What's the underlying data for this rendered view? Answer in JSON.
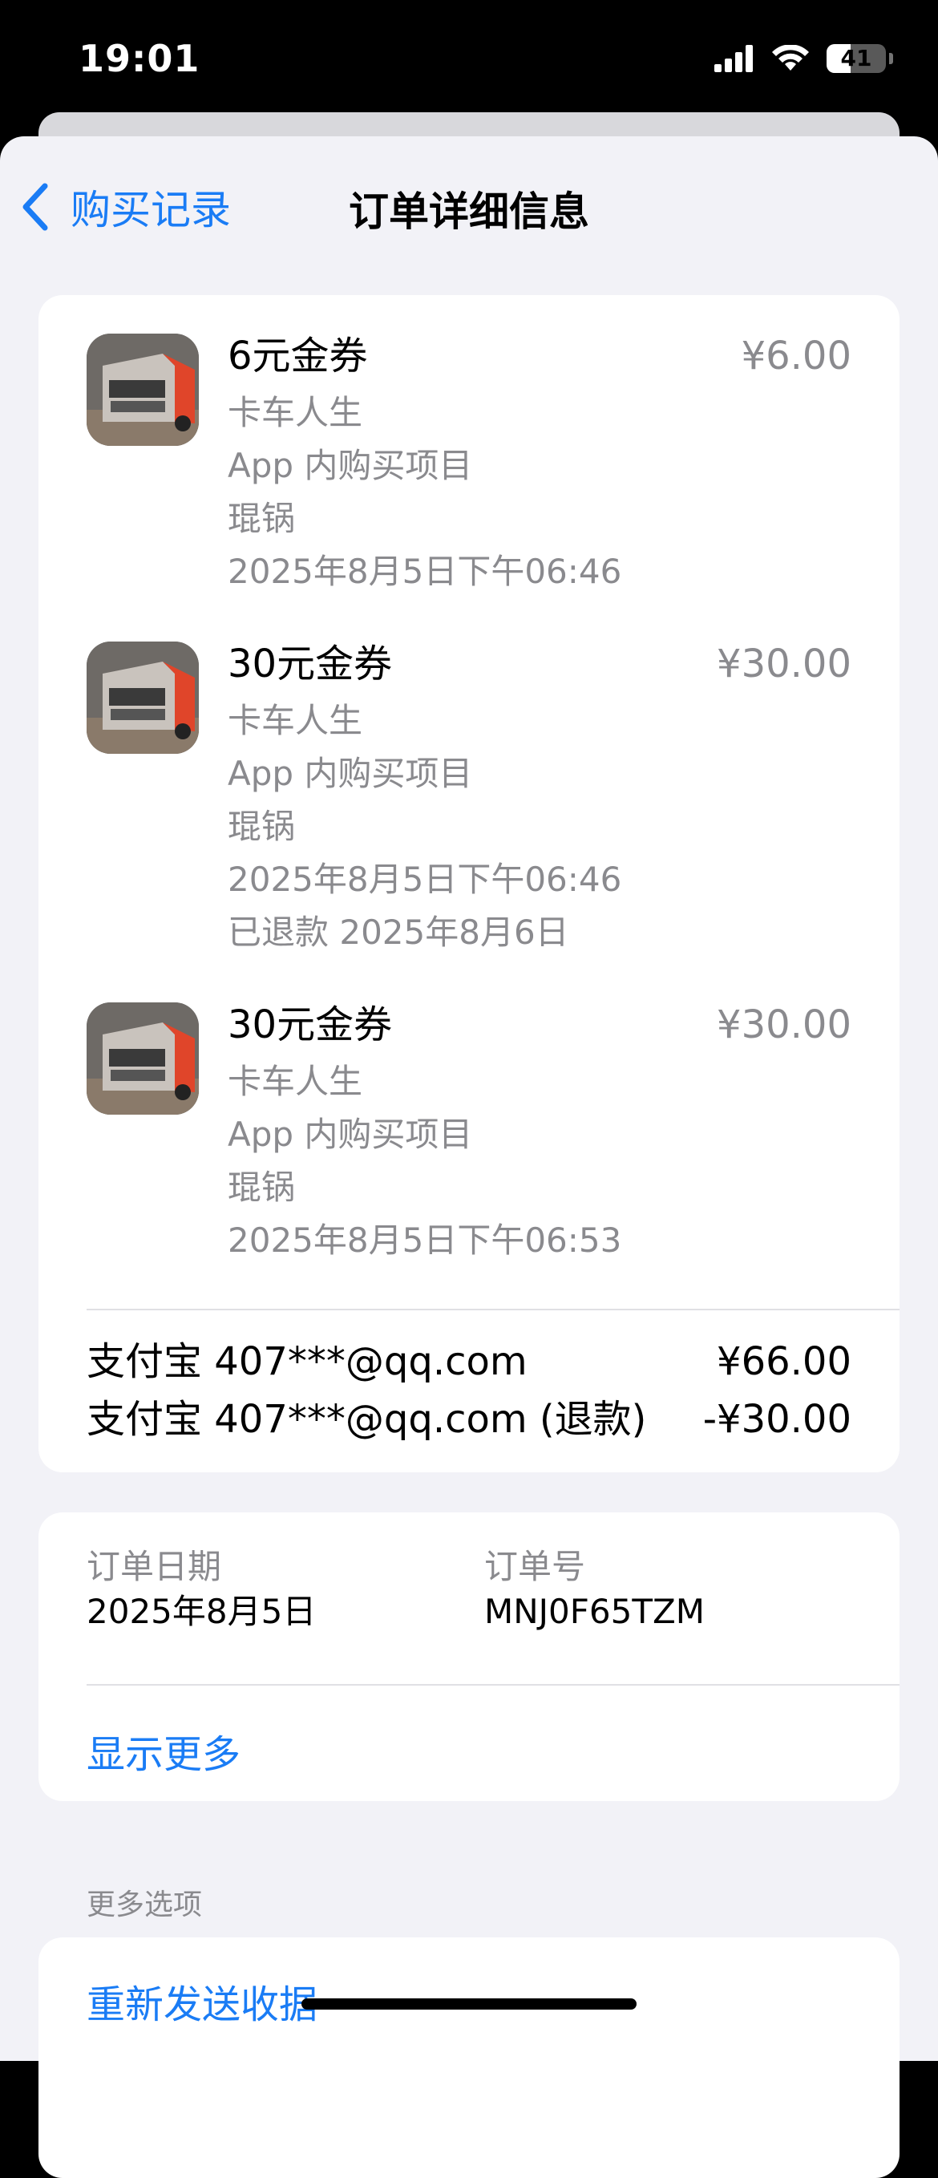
{
  "status": {
    "time": "19:01",
    "battery": "41"
  },
  "nav": {
    "back_label": "购买记录",
    "title": "订单详细信息"
  },
  "items": [
    {
      "title": "6元金券",
      "app": "卡车人生",
      "type": "App 内购买项目",
      "user": "琨锅",
      "datetime": "2025年8月5日下午06:46",
      "refund": "",
      "price": "¥6.00"
    },
    {
      "title": "30元金券",
      "app": "卡车人生",
      "type": "App 内购买项目",
      "user": "琨锅",
      "datetime": "2025年8月5日下午06:46",
      "refund": "已退款 2025年8月6日",
      "price": "¥30.00"
    },
    {
      "title": "30元金券",
      "app": "卡车人生",
      "type": "App 内购买项目",
      "user": "琨锅",
      "datetime": "2025年8月5日下午06:53",
      "refund": "",
      "price": "¥30.00"
    }
  ],
  "payments": [
    {
      "method": "支付宝 407***@qq.com",
      "amount": "¥66.00"
    },
    {
      "method": "支付宝 407***@qq.com (退款)",
      "amount": "-¥30.00"
    }
  ],
  "order": {
    "date_label": "订单日期",
    "date_value": "2025年8月5日",
    "number_label": "订单号",
    "number_value": "MNJ0F65TZM",
    "show_more": "显示更多"
  },
  "more_options": {
    "header": "更多选项",
    "resend_receipt": "重新发送收据"
  },
  "colors": {
    "accent": "#1a7cf5",
    "secondary_text": "#8a8a8e",
    "background": "#f2f2f7"
  }
}
